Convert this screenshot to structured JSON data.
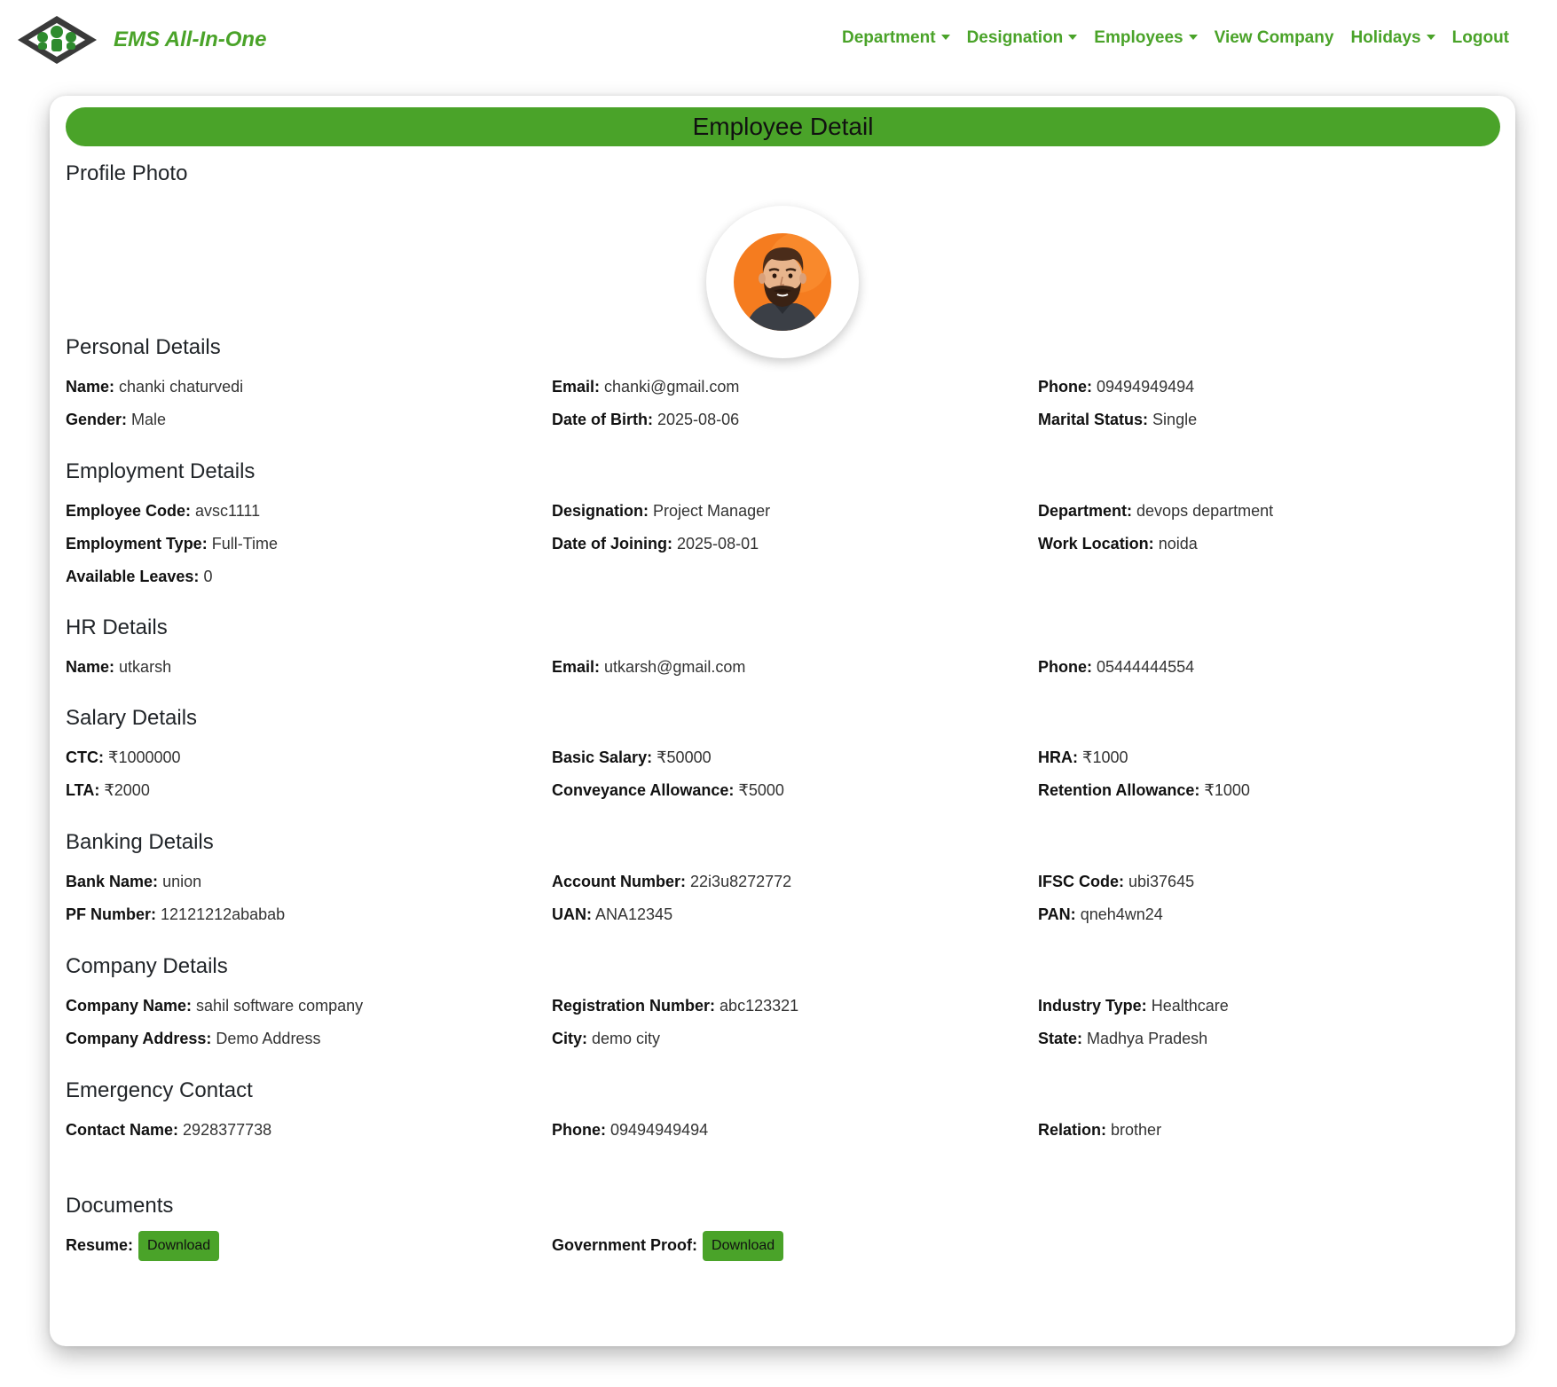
{
  "nav": {
    "brand": "EMS All-In-One",
    "items": [
      {
        "label": "Department",
        "dropdown": true
      },
      {
        "label": "Designation",
        "dropdown": true
      },
      {
        "label": "Employees",
        "dropdown": true
      },
      {
        "label": "View Company",
        "dropdown": false
      },
      {
        "label": "Holidays",
        "dropdown": true
      },
      {
        "label": "Logout",
        "dropdown": false
      }
    ]
  },
  "colors": {
    "accent": "#4aa329",
    "avatar_bg": "#f57c1f"
  },
  "card": {
    "title": "Employee Detail"
  },
  "profile": {
    "title": "Profile Photo"
  },
  "personal": {
    "title": "Personal Details",
    "name_l": "Name:",
    "name": "chanki chaturvedi",
    "email_l": "Email:",
    "email": "chanki@gmail.com",
    "phone_l": "Phone:",
    "phone": "09494949494",
    "gender_l": "Gender:",
    "gender": "Male",
    "dob_l": "Date of Birth:",
    "dob": "2025-08-06",
    "marital_l": "Marital Status:",
    "marital": "Single"
  },
  "employment": {
    "title": "Employment Details",
    "code_l": "Employee Code:",
    "code": "avsc1111",
    "designation_l": "Designation:",
    "designation": "Project Manager",
    "department_l": "Department:",
    "department": "devops department",
    "type_l": "Employment Type:",
    "type": "Full-Time",
    "doj_l": "Date of Joining:",
    "doj": "2025-08-01",
    "location_l": "Work Location:",
    "location": "noida",
    "leaves_l": "Available Leaves:",
    "leaves": "0"
  },
  "hr": {
    "title": "HR Details",
    "name_l": "Name:",
    "name": "utkarsh",
    "email_l": "Email:",
    "email": "utkarsh@gmail.com",
    "phone_l": "Phone:",
    "phone": "05444444554"
  },
  "salary": {
    "title": "Salary Details",
    "ctc_l": "CTC:",
    "ctc": "₹1000000",
    "basic_l": "Basic Salary:",
    "basic": "₹50000",
    "hra_l": "HRA:",
    "hra": "₹1000",
    "lta_l": "LTA:",
    "lta": "₹2000",
    "conv_l": "Conveyance Allowance:",
    "conv": "₹5000",
    "ret_l": "Retention Allowance:",
    "ret": "₹1000"
  },
  "banking": {
    "title": "Banking Details",
    "bank_l": "Bank Name:",
    "bank": "union",
    "acct_l": "Account Number:",
    "acct": "22i3u8272772",
    "ifsc_l": "IFSC Code:",
    "ifsc": "ubi37645",
    "pf_l": "PF Number:",
    "pf": "12121212ababab",
    "uan_l": "UAN:",
    "uan": "ANA12345",
    "pan_l": "PAN:",
    "pan": "qneh4wn24"
  },
  "company": {
    "title": "Company Details",
    "name_l": "Company Name:",
    "name": "sahil software company",
    "reg_l": "Registration Number:",
    "reg": "abc123321",
    "industry_l": "Industry Type:",
    "industry": "Healthcare",
    "addr_l": "Company Address:",
    "addr": "Demo Address",
    "city_l": "City:",
    "city": "demo city",
    "state_l": "State:",
    "state": "Madhya Pradesh"
  },
  "emergency": {
    "title": "Emergency Contact",
    "name_l": "Contact Name:",
    "name": "2928377738",
    "phone_l": "Phone:",
    "phone": "09494949494",
    "relation_l": "Relation:",
    "relation": "brother"
  },
  "documents": {
    "title": "Documents",
    "resume_l": "Resume:",
    "resume_btn": "Download",
    "gov_l": "Government Proof:",
    "gov_btn": "Download"
  }
}
